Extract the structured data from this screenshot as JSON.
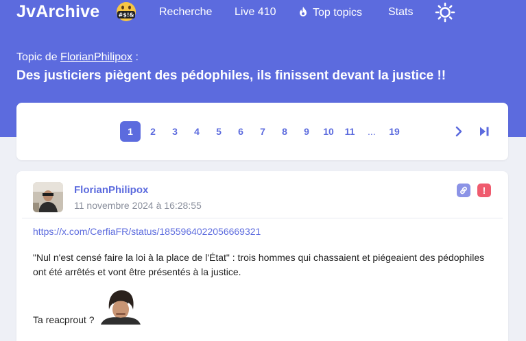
{
  "nav": {
    "logo": "JvArchive",
    "logo_badge": "#$!&",
    "links": [
      "Recherche",
      "Live 410",
      "Top topics",
      "Stats"
    ],
    "theme_icon": "sun-icon"
  },
  "topic": {
    "by_prefix": "Topic de",
    "author": "FlorianPhilipox",
    "by_suffix": ":",
    "title": "Des justiciers piègent des pédophiles, ils finissent devant la justice !!"
  },
  "pagination": {
    "current": "1",
    "pages": [
      "2",
      "3",
      "4",
      "5",
      "6",
      "7",
      "8",
      "9",
      "10",
      "11"
    ],
    "ellipsis": "...",
    "last": "19"
  },
  "message": {
    "author": "FlorianPhilipox",
    "date": "11 novembre 2024 à 16:28:55",
    "link": "https://x.com/CerfiaFR/status/1855964022056669321",
    "text": "\"Nul n'est censé faire la loi à la place de l'État\" : trois hommes qui chassaient et piégeaient des pédophiles ont été arrêtés et vont être présentés à la justice.",
    "text2": "Ta reacprout ?",
    "report_label": "!"
  },
  "colors": {
    "accent": "#5c6bde",
    "background": "#eef0f6",
    "report": "#ef5b6e",
    "link_btn": "#8b93e6"
  }
}
